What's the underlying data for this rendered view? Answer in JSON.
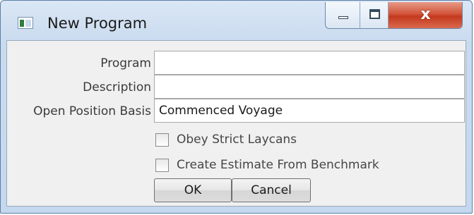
{
  "window": {
    "title": "New Program",
    "close_glyph": "x"
  },
  "icons": {
    "app": "app-window-icon",
    "minimize": "minimize-icon",
    "maximize": "maximize-icon",
    "close": "close-icon"
  },
  "form": {
    "program_label": "Program",
    "program_value": "",
    "description_label": "Description",
    "description_value": "",
    "open_position_basis_label": "Open Position Basis",
    "open_position_basis_value": "Commenced Voyage",
    "obey_strict_laycans_label": "Obey Strict Laycans",
    "obey_strict_laycans_checked": false,
    "create_estimate_label": "Create Estimate From Benchmark",
    "create_estimate_checked": false
  },
  "buttons": {
    "ok_label": "OK",
    "cancel_label": "Cancel"
  },
  "colors": {
    "titlebar": "#c9dbef",
    "close_button": "#c4391e",
    "client_background": "#f0f0f0"
  }
}
